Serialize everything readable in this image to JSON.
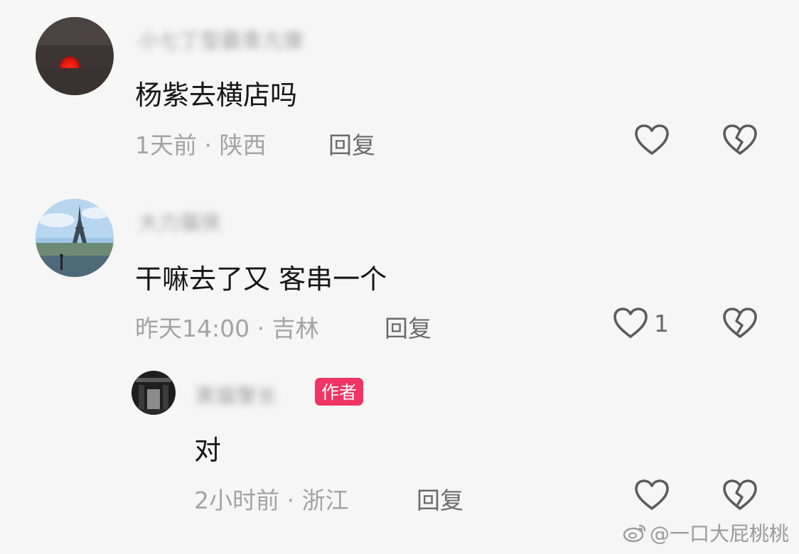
{
  "comments": [
    {
      "username": "小七丁型霸青亢傈",
      "text": "杨紫去横店吗",
      "meta": "1天前 · 陕西",
      "reply_label": "回复",
      "like_count": ""
    },
    {
      "username": "大力猫侠",
      "text": "干嘛去了又 客串一个",
      "meta": "昨天14:00 · 吉林",
      "reply_label": "回复",
      "like_count": "1"
    },
    {
      "username": "黑猫警长",
      "author_badge": "作者",
      "text": "对",
      "meta": "2小时前 · 浙江",
      "reply_label": "回复",
      "like_count": ""
    }
  ],
  "icons": {
    "like": "heart-outline-icon",
    "dislike": "broken-heart-icon",
    "watermark": "weibo-logo-icon"
  },
  "colors": {
    "background": "#f6f6f6",
    "text": "#161616",
    "meta": "#a3a3a3",
    "author_badge": "#f03463"
  },
  "watermark": {
    "text": "@一口大屁桃桃"
  }
}
